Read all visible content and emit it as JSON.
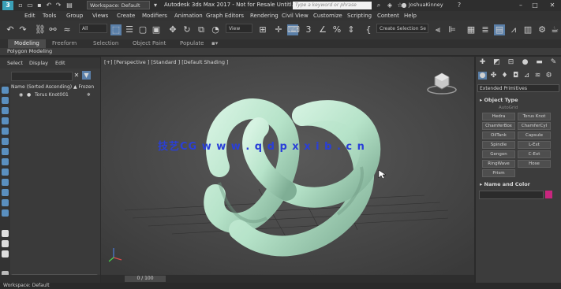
{
  "titlebar": {
    "logo": "3",
    "workspace_label": "Workspace: Default",
    "app_title": "Autodesk 3ds Max 2017 - Not for Resale   Untitl...",
    "search_placeholder": "Type a keyword or phrase",
    "user": "JoshuaKinney",
    "min": "–",
    "max": "□",
    "close": "✕"
  },
  "menus": [
    "Edit",
    "Tools",
    "Group",
    "Views",
    "Create",
    "Modifiers",
    "Animation",
    "Graph Editors",
    "Rendering",
    "Civil View",
    "Customize",
    "Scripting",
    "Content",
    "Help"
  ],
  "toolbar": {
    "selection_filter": "All",
    "ref_coord": "View",
    "selection_set": "Create Selection Se"
  },
  "ribbon": {
    "tabs": [
      "Modeling",
      "Freeform",
      "Selection",
      "Object Paint",
      "Populate"
    ],
    "active_tab": "Modeling",
    "sub_label": "Polygon Modeling"
  },
  "explorer": {
    "tabs": [
      "Select",
      "Display",
      "Edit"
    ],
    "header_name": "Name (Sorted Ascending)",
    "header_frozen": "▲ Frozen",
    "object": "Torus Knot001"
  },
  "viewport": {
    "label": "[+] [Perspective ] [Standard ] [Default Shading ]",
    "watermark": "技艺CG  w w w . q d p x x i b . c n"
  },
  "timeline": {
    "frame": "0 / 100"
  },
  "status": {
    "workspace": "Workspace: Default"
  },
  "command_panel": {
    "category": "Extended Primitives",
    "object_type_title": "Object Type",
    "autogrid": "AutoGrid",
    "primitives": [
      "Hedra",
      "Torus Knot",
      "ChamferBox",
      "ChamferCyl",
      "OilTank",
      "Capsule",
      "Spindle",
      "L-Ext",
      "Gengon",
      "C-Ext",
      "RingWave",
      "Hose",
      "Prism"
    ],
    "name_color_title": "Name and Color",
    "object_color": "#c8267e"
  },
  "colors": {
    "viewport_bg": "#4d4d4d",
    "knot": "#b8e6cc",
    "accent": "#5a7fa8"
  }
}
